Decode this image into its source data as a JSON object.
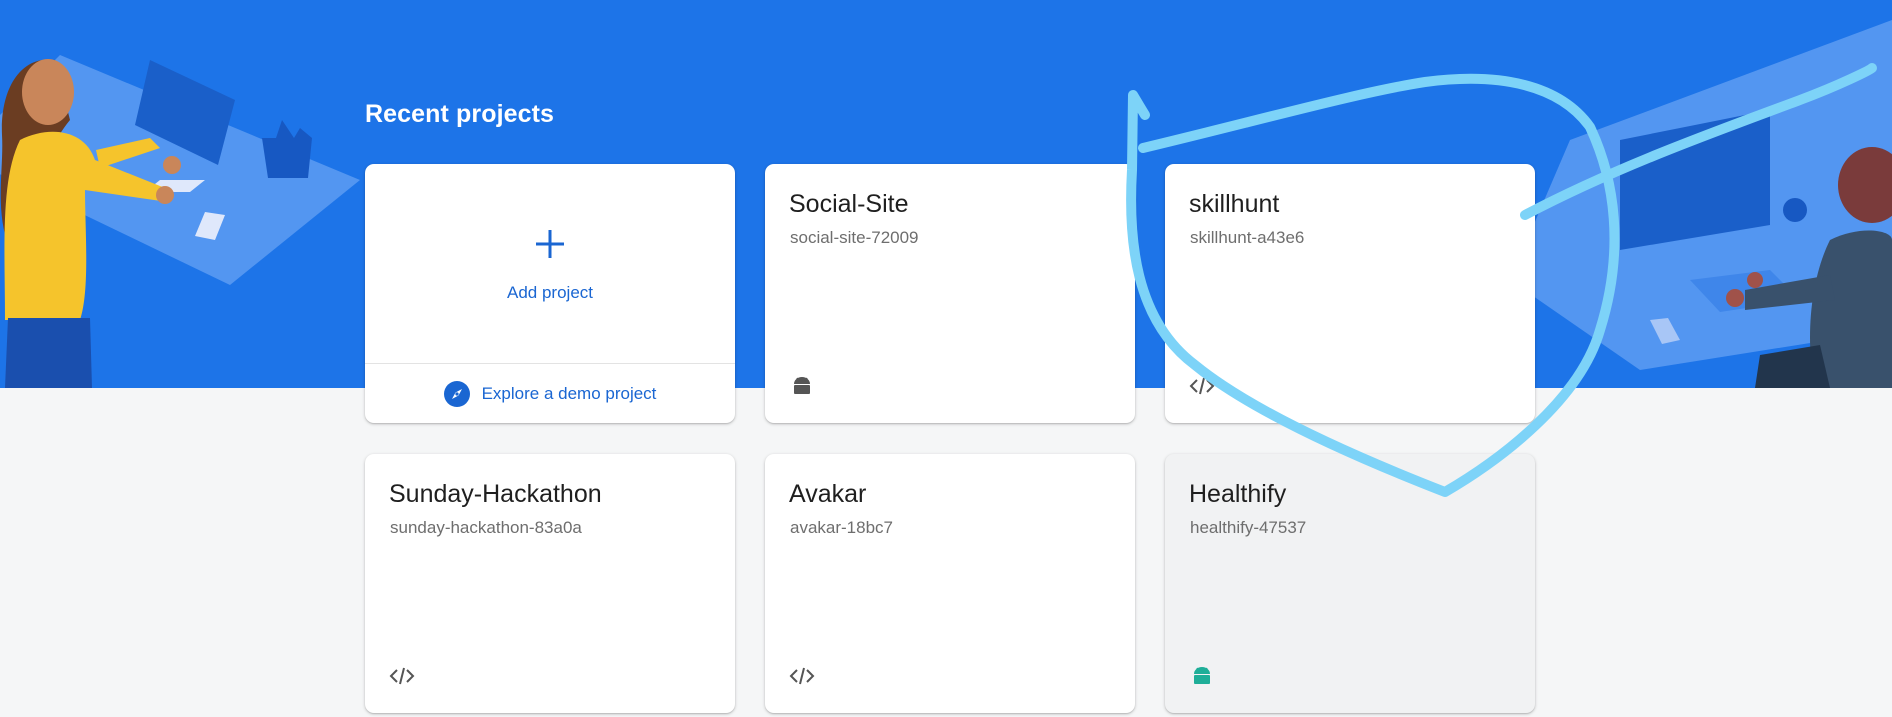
{
  "header": {
    "title": "Recent projects"
  },
  "add_card": {
    "add_label": "Add project",
    "demo_label": "Explore a demo project",
    "plus_icon": "plus-icon",
    "demo_icon": "compass-icon"
  },
  "projects": [
    {
      "name": "Social-Site",
      "id": "social-site-72009",
      "platform": "android-icon"
    },
    {
      "name": "skillhunt",
      "id": "skillhunt-a43e6",
      "platform": "web-code-icon"
    },
    {
      "name": "Sunday-Hackathon",
      "id": "sunday-hackathon-83a0a",
      "platform": "web-code-icon"
    },
    {
      "name": "Avakar",
      "id": "avakar-18bc7",
      "platform": "web-code-icon"
    },
    {
      "name": "Healthify",
      "id": "healthify-47537",
      "platform": "android-icon"
    }
  ],
  "colors": {
    "hero": "#1d74e8",
    "accent": "#1a66d2",
    "annotation": "#7dd3f8",
    "android_dark": "#555555",
    "android_teal": "#1fae98"
  }
}
